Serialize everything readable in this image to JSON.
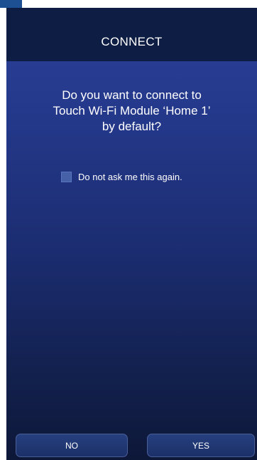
{
  "header": {
    "title": "CONNECT"
  },
  "dialog": {
    "question_lines": [
      "Do you want to connect to",
      "Touch Wi-Fi Module ‘Home 1’",
      "by default?"
    ],
    "checkbox_label": "Do not ask me this again.",
    "checkbox_checked": false
  },
  "buttons": {
    "no_label": "NO",
    "yes_label": "YES"
  },
  "colors": {
    "header_bg": "#0e1d43",
    "background_top": "#2b4197",
    "background_bottom": "#0d1738",
    "checkbox": "#4761a8"
  }
}
